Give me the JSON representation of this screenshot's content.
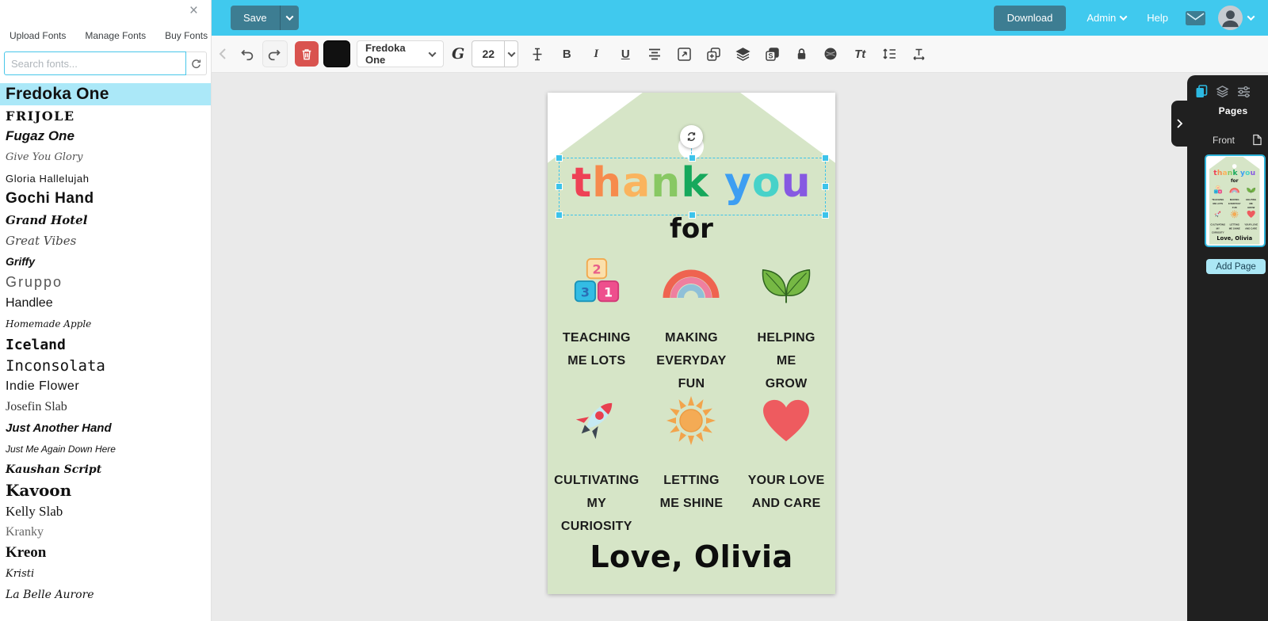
{
  "font_panel": {
    "tabs": [
      "Upload Fonts",
      "Manage Fonts",
      "Buy Fonts"
    ],
    "search_placeholder": "Search fonts...",
    "selected_font": "Fredoka One",
    "fonts": [
      "Fredoka One",
      "Frijole",
      "Fugaz One",
      "Give You Glory",
      "Gloria Hallelujah",
      "Gochi Hand",
      "Grand Hotel",
      "Great Vibes",
      "Griffy",
      "Gruppo",
      "Handlee",
      "Homemade Apple",
      "Iceland",
      "Inconsolata",
      "Indie Flower",
      "Josefin Slab",
      "Just Another Hand",
      "Just Me Again Down Here",
      "Kaushan Script",
      "Kavoon",
      "Kelly Slab",
      "Kranky",
      "Kreon",
      "Kristi",
      "La Belle Aurore"
    ]
  },
  "top_bar": {
    "save": "Save",
    "download": "Download",
    "admin": "Admin",
    "help": "Help",
    "icons": [
      "mail-icon",
      "avatar",
      "chevron-down-icon"
    ]
  },
  "toolbar": {
    "font_name": "Fredoka One",
    "font_size": "22",
    "bold_label": "B",
    "italic_label": "I",
    "underline_label": "U",
    "text_case_label": "Tt",
    "glyph_label": "G",
    "icons": [
      "back",
      "undo",
      "redo",
      "delete",
      "fill-color",
      "font-family",
      "glyph",
      "font-size",
      "text-cursor",
      "bold",
      "italic",
      "underline",
      "align-center",
      "resize",
      "duplicate",
      "layers",
      "swap",
      "lock",
      "texture",
      "text-case",
      "line-height",
      "letter-spacing"
    ]
  },
  "canvas": {
    "card": {
      "background": "#d6e5c7",
      "title_letters": [
        {
          "char": "t",
          "color": "#ee4155"
        },
        {
          "char": "h",
          "color": "#f68b4d"
        },
        {
          "char": "a",
          "color": "#fab45e"
        },
        {
          "char": "n",
          "color": "#88c863"
        },
        {
          "char": "k",
          "color": "#16a85c"
        },
        {
          "char": " "
        },
        {
          "char": "y",
          "color": "#3d9ef2"
        },
        {
          "char": "o",
          "color": "#47d2c9"
        },
        {
          "char": "u",
          "color": "#8659e2"
        }
      ],
      "subtitle": "for",
      "block_numbers": [
        "2",
        "3",
        "1"
      ],
      "items": [
        {
          "icon": "number-blocks-icon",
          "label": "TEACHING\nME LOTS"
        },
        {
          "icon": "rainbow-icon",
          "label": "MAKING\nEVERYDAY FUN"
        },
        {
          "icon": "leaves-icon",
          "label": "HELPING\nME\nGROW"
        },
        {
          "icon": "rocket-icon",
          "label": "CULTIVATING\nMY\nCURIOSITY"
        },
        {
          "icon": "sun-icon",
          "label": "LETTING\nME SHINE"
        },
        {
          "icon": "heart-icon",
          "label": "YOUR LOVE\nAND CARE"
        }
      ],
      "signature": "Love, Olivia"
    }
  },
  "pages_panel": {
    "title": "Pages",
    "page_name": "Front",
    "add_page": "Add Page"
  },
  "colors": {
    "topbar_cyan": "#40c9ee",
    "button_teal": "#3d7d92",
    "selection_cyan": "#3cc3ea",
    "trash_red": "#d9534f",
    "card_green": "#d6e5c7",
    "highlight_row": "#abe8f8",
    "panel_dark": "#202020",
    "add_page_bg": "#abe7f5"
  }
}
